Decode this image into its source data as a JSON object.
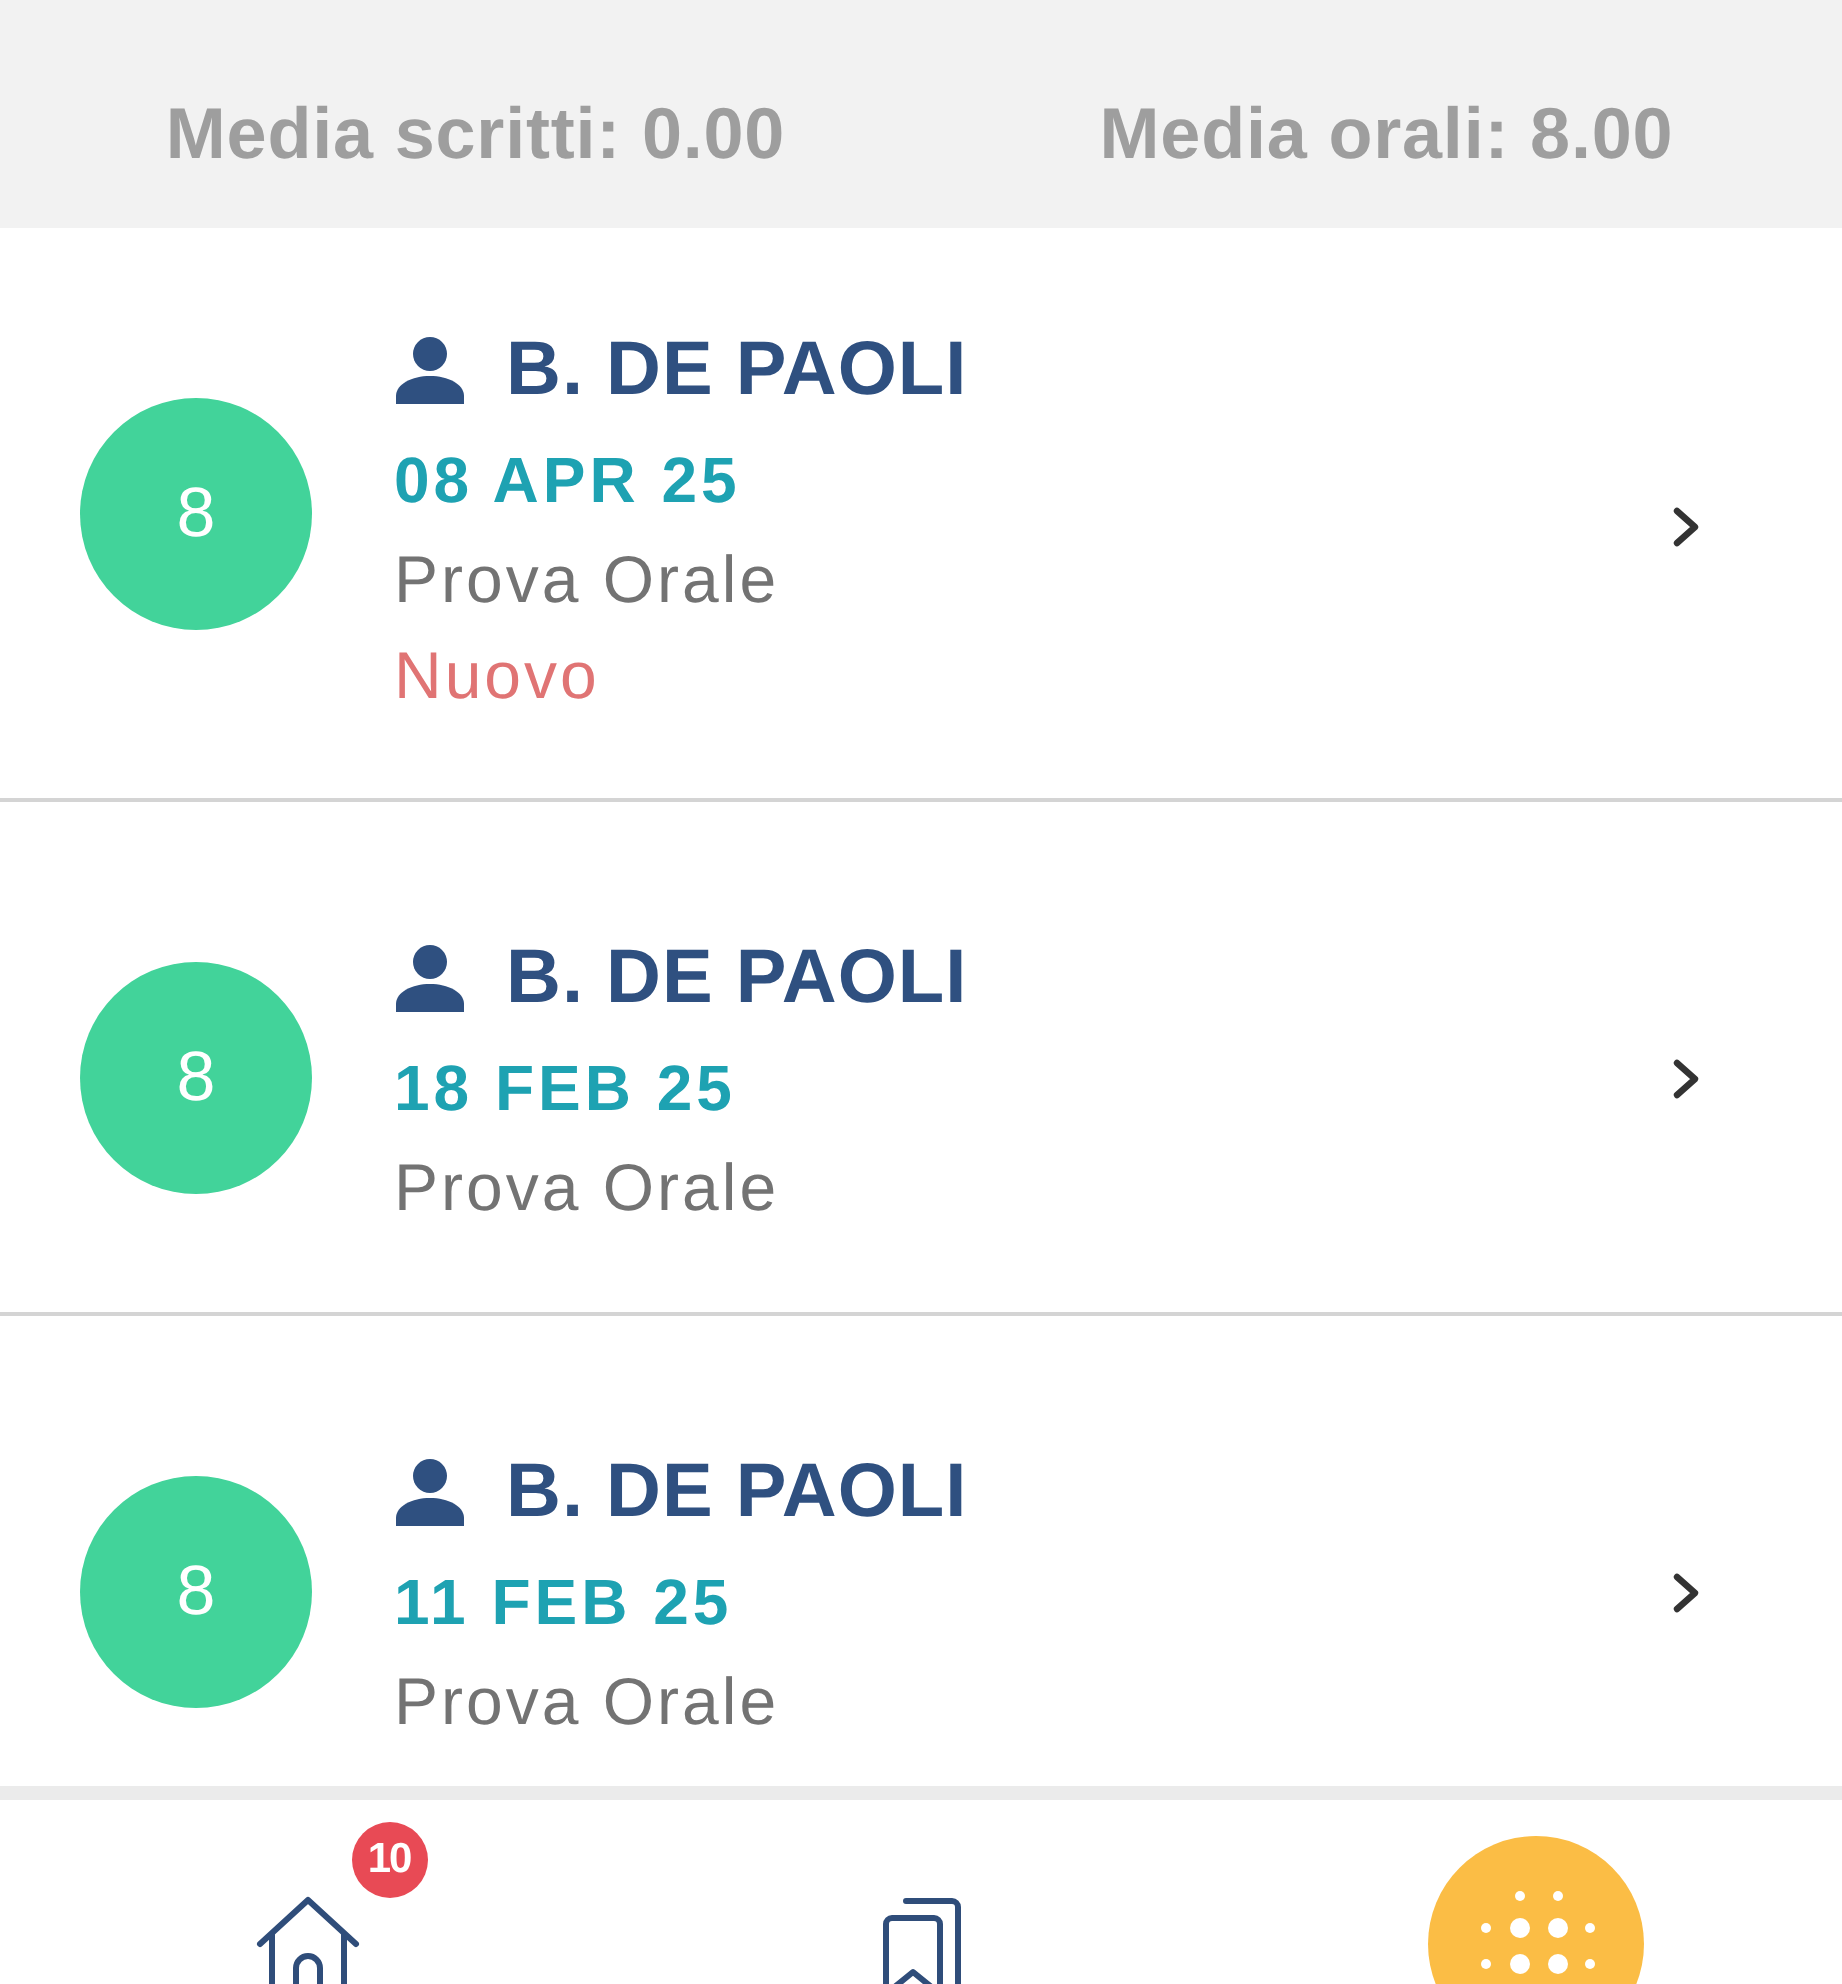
{
  "summary": {
    "items": [
      {
        "label": "Media scritti: 0.00"
      },
      {
        "label": "Media orali: 8.00"
      }
    ]
  },
  "grades": [
    {
      "grade": "8",
      "teacher": "B. DE PAOLI",
      "date": "08 APR 25",
      "type": "Prova Orale",
      "status": "Nuovo"
    },
    {
      "grade": "8",
      "teacher": "B. DE PAOLI",
      "date": "18 FEB 25",
      "type": "Prova Orale"
    },
    {
      "grade": "8",
      "teacher": "B. DE PAOLI",
      "date": "11 FEB 25",
      "type": "Prova Orale"
    }
  ],
  "nav": {
    "items": [
      {
        "kind": "home",
        "badge": "10"
      },
      {
        "kind": "bookmarks"
      },
      {
        "kind": "apps"
      }
    ]
  }
}
